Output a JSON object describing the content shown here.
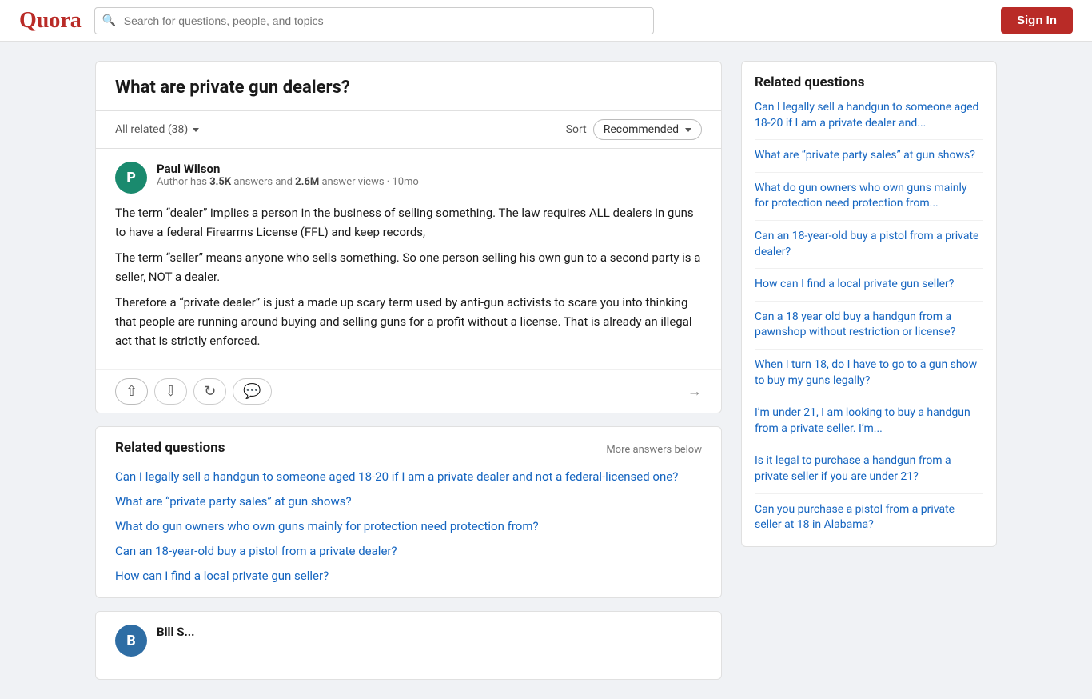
{
  "header": {
    "logo": "Quora",
    "search_placeholder": "Search for questions, people, and topics",
    "sign_in_label": "Sign In"
  },
  "question": {
    "title": "What are private gun dealers?",
    "all_related_label": "All related (38)",
    "sort_label": "Sort",
    "sort_value": "Recommended"
  },
  "answer": {
    "author_initial": "P",
    "author_name": "Paul Wilson",
    "author_meta_prefix": "Author has ",
    "answers_count": "3.5K",
    "answers_label": " answers and ",
    "views_count": "2.6M",
    "views_label": " answer views · 10mo",
    "paragraph1": "The term “dealer” implies a person in the business of selling something. The law requires ALL dealers in guns to have a federal Firearms License (FFL) and keep records,",
    "paragraph2": "The term “seller” means anyone who sells something. So one person selling his own gun to a second party is a seller, NOT a dealer.",
    "paragraph3": "Therefore a “private dealer” is just a made up scary term used by anti-gun activists to scare you into thinking that people are running around buying and selling guns for a profit without a license. That is already an illegal act that is strictly enforced."
  },
  "related_questions": {
    "title": "Related questions",
    "more_answers_label": "More answers below",
    "links": [
      "Can I legally sell a handgun to someone aged 18-20 if I am a private dealer and not a federal-licensed one?",
      "What are “private party sales” at gun shows?",
      "What do gun owners who own guns mainly for protection need protection from?",
      "Can an 18-year-old buy a pistol from a private dealer?",
      "How can I find a local private gun seller?"
    ]
  },
  "right_sidebar": {
    "title": "Related questions",
    "links": [
      "Can I legally sell a handgun to someone aged 18-20 if I am a private dealer and...",
      "What are “private party sales” at gun shows?",
      "What do gun owners who own guns mainly for protection need protection from...",
      "Can an 18-year-old buy a pistol from a private dealer?",
      "How can I find a local private gun seller?",
      "Can a 18 year old buy a handgun from a pawnshop without restriction or license?",
      "When I turn 18, do I have to go to a gun show to buy my guns legally?",
      "I’m under 21, I am looking to buy a handgun from a private seller. I’m...",
      "Is it legal to purchase a handgun from a private seller if you are under 21?",
      "Can you purchase a pistol from a private seller at 18 in Alabama?"
    ]
  },
  "second_answer": {
    "author_initial": "B",
    "author_name": "Bill S..."
  },
  "icons": {
    "search": "🔍",
    "upvote": "↑",
    "downvote": "↓",
    "share_icon": "→",
    "comment": "💬",
    "repost": "↺"
  }
}
